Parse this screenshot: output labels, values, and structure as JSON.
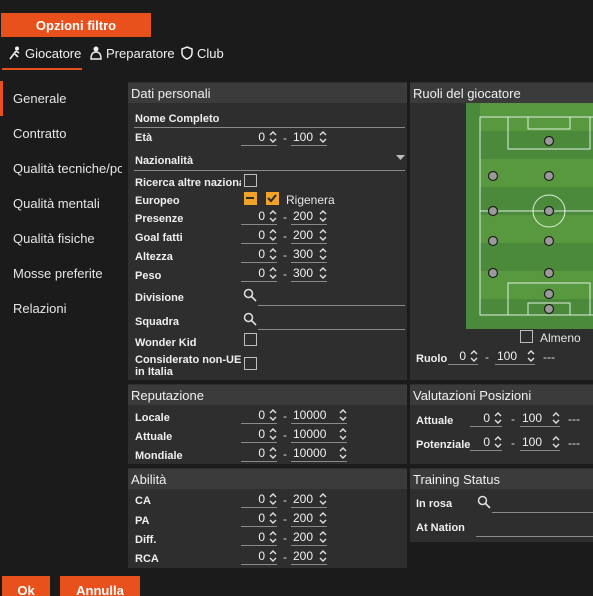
{
  "header": {
    "filter_button": "Opzioni filtro"
  },
  "tabs": [
    {
      "label": "Giocatore",
      "icon": "player-icon",
      "active": true
    },
    {
      "label": "Preparatore",
      "icon": "coach-icon"
    },
    {
      "label": "Club",
      "icon": "shield-icon"
    }
  ],
  "sidebar": {
    "items": [
      {
        "label": "Generale",
        "active": true
      },
      {
        "label": "Contratto"
      },
      {
        "label": "Qualità tecniche/portiere"
      },
      {
        "label": "Qualità mentali"
      },
      {
        "label": "Qualità fisiche"
      },
      {
        "label": "Mosse preferite"
      },
      {
        "label": "Relazioni"
      }
    ]
  },
  "personal": {
    "title": "Dati personali",
    "full_name_label": "Nome Completo",
    "age_label": "Età",
    "age_min": "0",
    "age_max": "100",
    "nationality_label": "Nazionalità",
    "other_nat_label": "Ricerca altre nazionalità",
    "european_label": "Europeo",
    "regen_label": "Rigenera",
    "apps_label": "Presenze",
    "apps_min": "0",
    "apps_max": "200",
    "goals_label": "Goal fatti",
    "goals_min": "0",
    "goals_max": "200",
    "height_label": "Altezza",
    "height_min": "0",
    "height_max": "300",
    "weight_label": "Peso",
    "weight_min": "0",
    "weight_max": "300",
    "division_label": "Divisione",
    "team_label": "Squadra",
    "wonderkid_label": "Wonder Kid",
    "nonue_label_1": "Considerato non-UE",
    "nonue_label_2": "in Italia"
  },
  "reputation": {
    "title": "Reputazione",
    "local_label": "Locale",
    "local_min": "0",
    "local_max": "10000",
    "current_label": "Attuale",
    "current_min": "0",
    "current_max": "10000",
    "world_label": "Mondiale",
    "world_min": "0",
    "world_max": "10000"
  },
  "ability": {
    "title": "Abilità",
    "ca_label": "CA",
    "ca_min": "0",
    "ca_max": "200",
    "pa_label": "PA",
    "pa_min": "0",
    "pa_max": "200",
    "diff_label": "Diff.",
    "diff_min": "0",
    "diff_max": "200",
    "rca_label": "RCA",
    "rca_min": "0",
    "rca_max": "200"
  },
  "roles": {
    "title": "Ruoli del giocatore",
    "almeno_label": "Almeno",
    "ruolo_label": "Ruolo",
    "ruolo_min": "0",
    "ruolo_max": "100",
    "ruolo_extra": "---"
  },
  "ratings": {
    "title": "Valutazioni Posizioni",
    "current_label": "Attuale",
    "current_min": "0",
    "current_max": "100",
    "current_extra": "---",
    "potential_label": "Potenziale",
    "potential_min": "0",
    "potential_max": "100",
    "potential_extra": "---"
  },
  "training": {
    "title": "Training Status",
    "squad_label": "In rosa",
    "nation_label": "At Nation"
  },
  "footer": {
    "ok": "Ok",
    "cancel": "Annulla"
  },
  "colors": {
    "accent": "#e8501c",
    "checkbox_on": "#f0a22a",
    "pitch": "#4a8a3a"
  }
}
